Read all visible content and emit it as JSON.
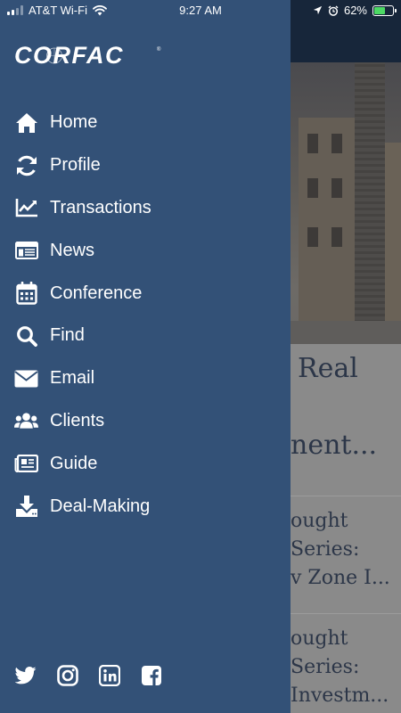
{
  "status_bar": {
    "carrier": "AT&T Wi-Fi",
    "time": "9:27 AM",
    "battery_percent": "62%",
    "battery_level": 0.62
  },
  "brand": {
    "logo_text": "CORFAC",
    "drawer_color": "#335177"
  },
  "menu": {
    "items": [
      {
        "label": "Home",
        "icon": "home-icon"
      },
      {
        "label": "Profile",
        "icon": "refresh-icon"
      },
      {
        "label": "Transactions",
        "icon": "chart-line-icon"
      },
      {
        "label": "News",
        "icon": "newspaper-icon"
      },
      {
        "label": "Conference",
        "icon": "calendar-icon"
      },
      {
        "label": "Find",
        "icon": "search-icon"
      },
      {
        "label": "Email",
        "icon": "envelope-icon"
      },
      {
        "label": "Clients",
        "icon": "users-icon"
      },
      {
        "label": "Guide",
        "icon": "guide-icon"
      },
      {
        "label": "Deal-Making",
        "icon": "download-icon"
      }
    ]
  },
  "social": [
    "twitter-icon",
    "instagram-icon",
    "linkedin-icon",
    "facebook-icon"
  ],
  "background": {
    "lines": [
      "Real",
      "nent...",
      "ought",
      "Series:",
      "v Zone I...",
      "ought",
      "Series:",
      "Investm..."
    ]
  }
}
